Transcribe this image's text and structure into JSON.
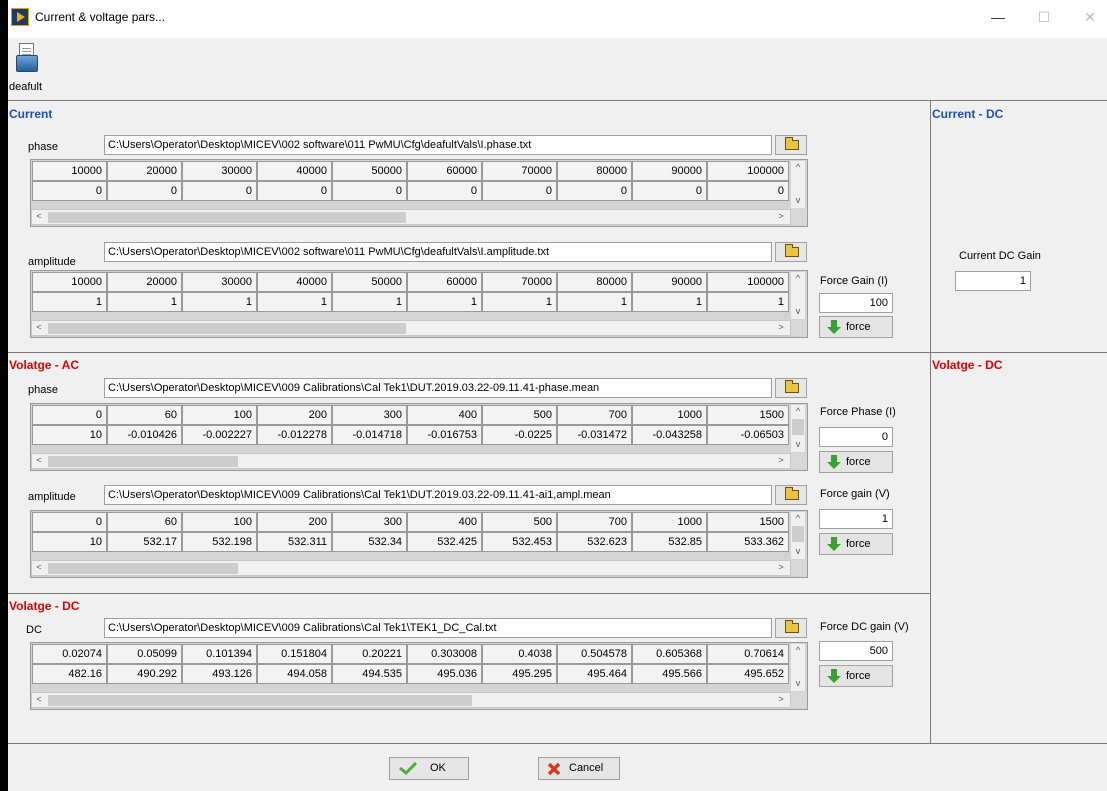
{
  "window": {
    "title": "Current & voltage pars...",
    "minimize": "—",
    "maximize": "☐",
    "close": "✕"
  },
  "toolbar": {
    "default_label": "deafult"
  },
  "current": {
    "title": "Current",
    "phase": {
      "label": "phase",
      "path": "C:\\Users\\Operator\\Desktop\\MICEV\\002 software\\011 PwMU\\Cfg\\deafultVals\\I.phase.txt",
      "rows": [
        [
          "10000",
          "20000",
          "30000",
          "40000",
          "50000",
          "60000",
          "70000",
          "80000",
          "90000",
          "100000"
        ],
        [
          "0",
          "0",
          "0",
          "0",
          "0",
          "0",
          "0",
          "0",
          "0",
          "0"
        ]
      ]
    },
    "amplitude": {
      "label": "amplitude",
      "path": "C:\\Users\\Operator\\Desktop\\MICEV\\002 software\\011 PwMU\\Cfg\\deafultVals\\I.amplitude.txt",
      "rows": [
        [
          "10000",
          "20000",
          "30000",
          "40000",
          "50000",
          "60000",
          "70000",
          "80000",
          "90000",
          "100000"
        ],
        [
          "1",
          "1",
          "1",
          "1",
          "1",
          "1",
          "1",
          "1",
          "1",
          "1"
        ]
      ]
    },
    "force_gain": {
      "label": "Force Gain (I)",
      "value": "100",
      "button": "force"
    }
  },
  "current_dc": {
    "title": "Current - DC",
    "gain_label": "Current DC Gain",
    "gain_value": "1"
  },
  "voltage_ac": {
    "title": "Volatge - AC",
    "phase": {
      "label": "phase",
      "path": "C:\\Users\\Operator\\Desktop\\MICEV\\009 Calibrations\\Cal Tek1\\DUT.2019.03.22-09.11.41-phase.mean",
      "rows": [
        [
          "0",
          "60",
          "100",
          "200",
          "300",
          "400",
          "500",
          "700",
          "1000",
          "1500"
        ],
        [
          "10",
          "-0.010426",
          "-0.002227",
          "-0.012278",
          "-0.014718",
          "-0.016753",
          "-0.0225",
          "-0.031472",
          "-0.043258",
          "-0.06503"
        ]
      ]
    },
    "amplitude": {
      "label": "amplitude",
      "path": "C:\\Users\\Operator\\Desktop\\MICEV\\009 Calibrations\\Cal Tek1\\DUT.2019.03.22-09.11.41-ai1,ampl.mean",
      "rows": [
        [
          "0",
          "60",
          "100",
          "200",
          "300",
          "400",
          "500",
          "700",
          "1000",
          "1500"
        ],
        [
          "10",
          "532.17",
          "532.198",
          "532.311",
          "532.34",
          "532.425",
          "532.453",
          "532.623",
          "532.85",
          "533.362"
        ]
      ]
    },
    "force_phase": {
      "label": "Force Phase (I)",
      "value": "0",
      "button": "force"
    },
    "force_gain": {
      "label": "Force gain (V)",
      "value": "1",
      "button": "force"
    }
  },
  "voltage_dc_right": {
    "title": "Volatge - DC"
  },
  "voltage_dc": {
    "title": "Volatge - DC",
    "dc": {
      "label": "DC",
      "path": "C:\\Users\\Operator\\Desktop\\MICEV\\009 Calibrations\\Cal Tek1\\TEK1_DC_Cal.txt",
      "rows": [
        [
          "0.02074",
          "0.05099",
          "0.101394",
          "0.151804",
          "0.20221",
          "0.303008",
          "0.4038",
          "0.504578",
          "0.605368",
          "0.70614"
        ],
        [
          "482.16",
          "490.292",
          "493.126",
          "494.058",
          "494.535",
          "495.036",
          "495.295",
          "495.464",
          "495.566",
          "495.652"
        ]
      ]
    },
    "force_dc_gain": {
      "label": "Force DC gain (V)",
      "value": "500",
      "button": "force"
    }
  },
  "buttons": {
    "ok": "OK",
    "cancel": "Cancel"
  },
  "colors": {
    "section_blue": "#1f4fbf",
    "section_red": "#e00000",
    "ok_check": "#4caf3a",
    "cancel_x": "#d93a1a",
    "force_arrow": "#3aa02e"
  }
}
